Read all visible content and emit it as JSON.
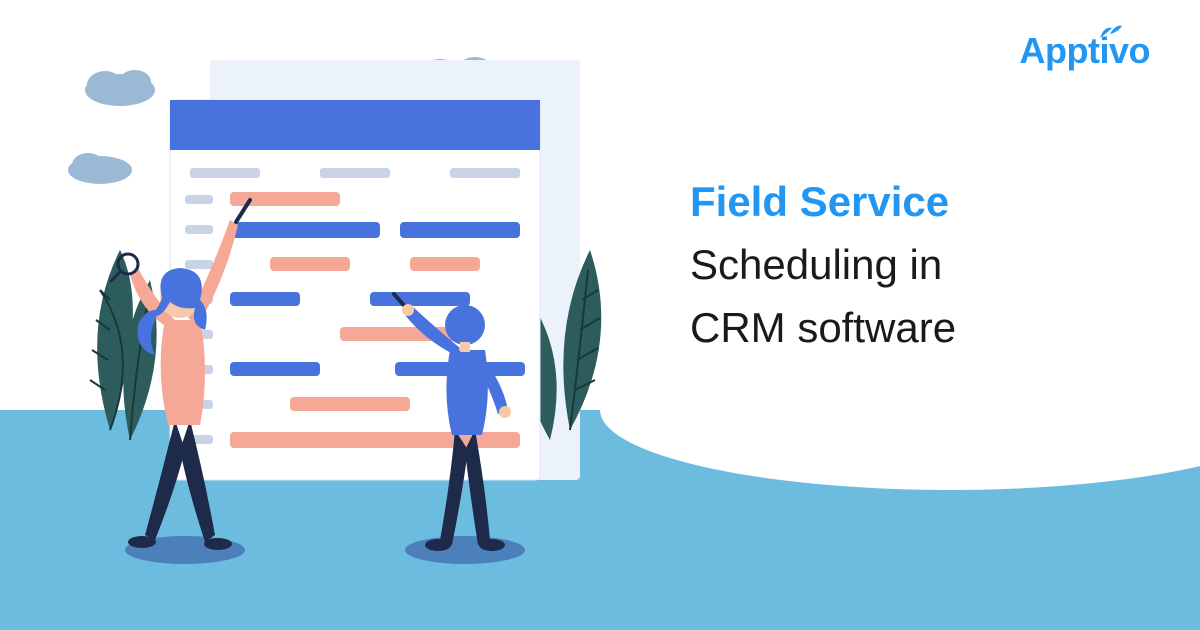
{
  "logo": {
    "text": "Apptivo"
  },
  "headline": {
    "line1": "Field Service",
    "line2": "Scheduling in",
    "line3": "CRM software"
  },
  "colors": {
    "brand": "#2196f3",
    "wave": "#6cbce0",
    "accent_orange": "#f5a896",
    "accent_blue": "#4872dd",
    "dark_text": "#1a1a1a",
    "leaf": "#2d5c5c"
  },
  "illustration": {
    "description": "Two people pointing at a large schedule board with colored bars, with plants and clouds around them",
    "icons": [
      "cloud-icon",
      "leaf-plant-icon",
      "schedule-board-icon",
      "person-figure-icon"
    ]
  }
}
